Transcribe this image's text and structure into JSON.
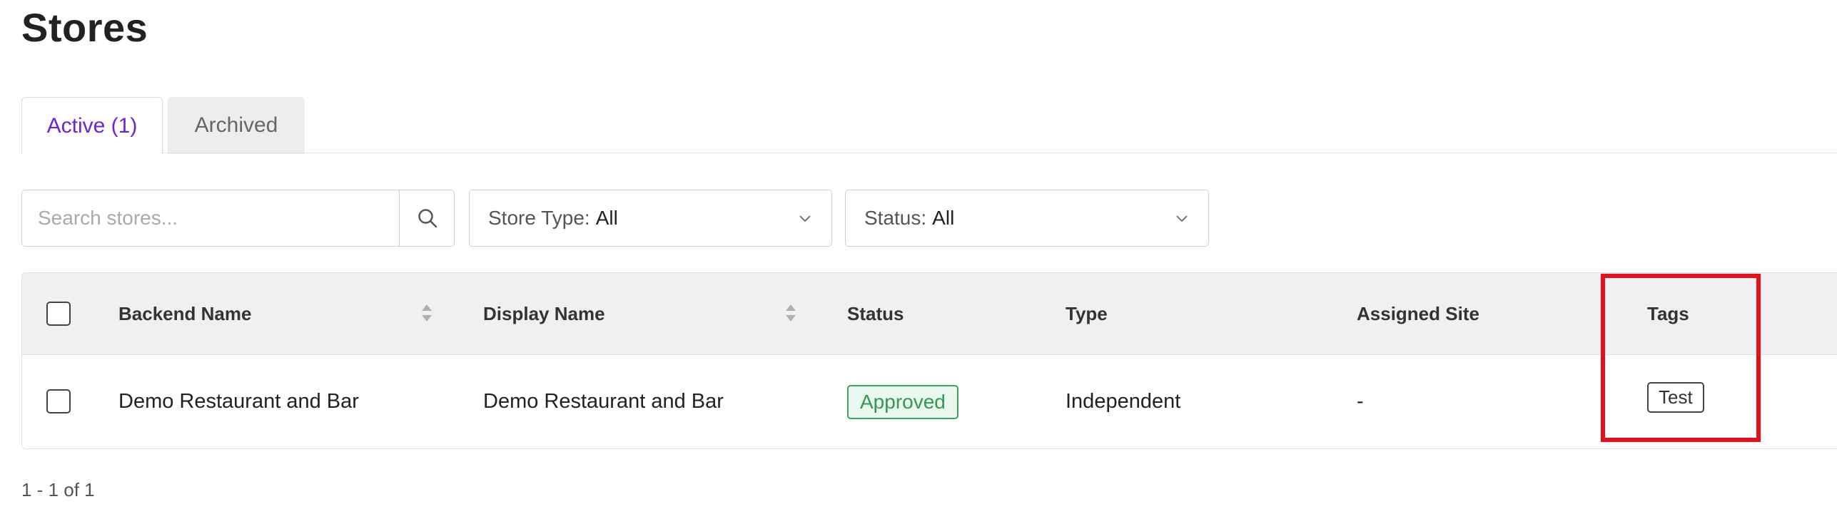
{
  "page": {
    "title": "Stores"
  },
  "tabs": {
    "active": "Active (1)",
    "archived": "Archived"
  },
  "filters": {
    "search_placeholder": "Search stores...",
    "store_type_label": "Store Type:",
    "store_type_value": "All",
    "status_label": "Status:",
    "status_value": "All"
  },
  "table": {
    "headers": {
      "backend_name": "Backend Name",
      "display_name": "Display Name",
      "status": "Status",
      "type": "Type",
      "assigned_site": "Assigned Site",
      "tags": "Tags"
    },
    "rows": [
      {
        "backend_name": "Demo Restaurant and Bar",
        "display_name": "Demo Restaurant and Bar",
        "status": "Approved",
        "type": "Independent",
        "assigned_site": "-",
        "tag": "Test"
      }
    ]
  },
  "pagination": {
    "text": "1 - 1 of 1"
  },
  "colors": {
    "accent": "#6b24d6",
    "approved_green": "#2f9a4f",
    "highlight_red": "#e3101c",
    "header_bg": "#f0f0f0"
  },
  "icons": {
    "search": "search-icon",
    "chevron": "chevron-down-icon",
    "sort": "sort-icon"
  }
}
